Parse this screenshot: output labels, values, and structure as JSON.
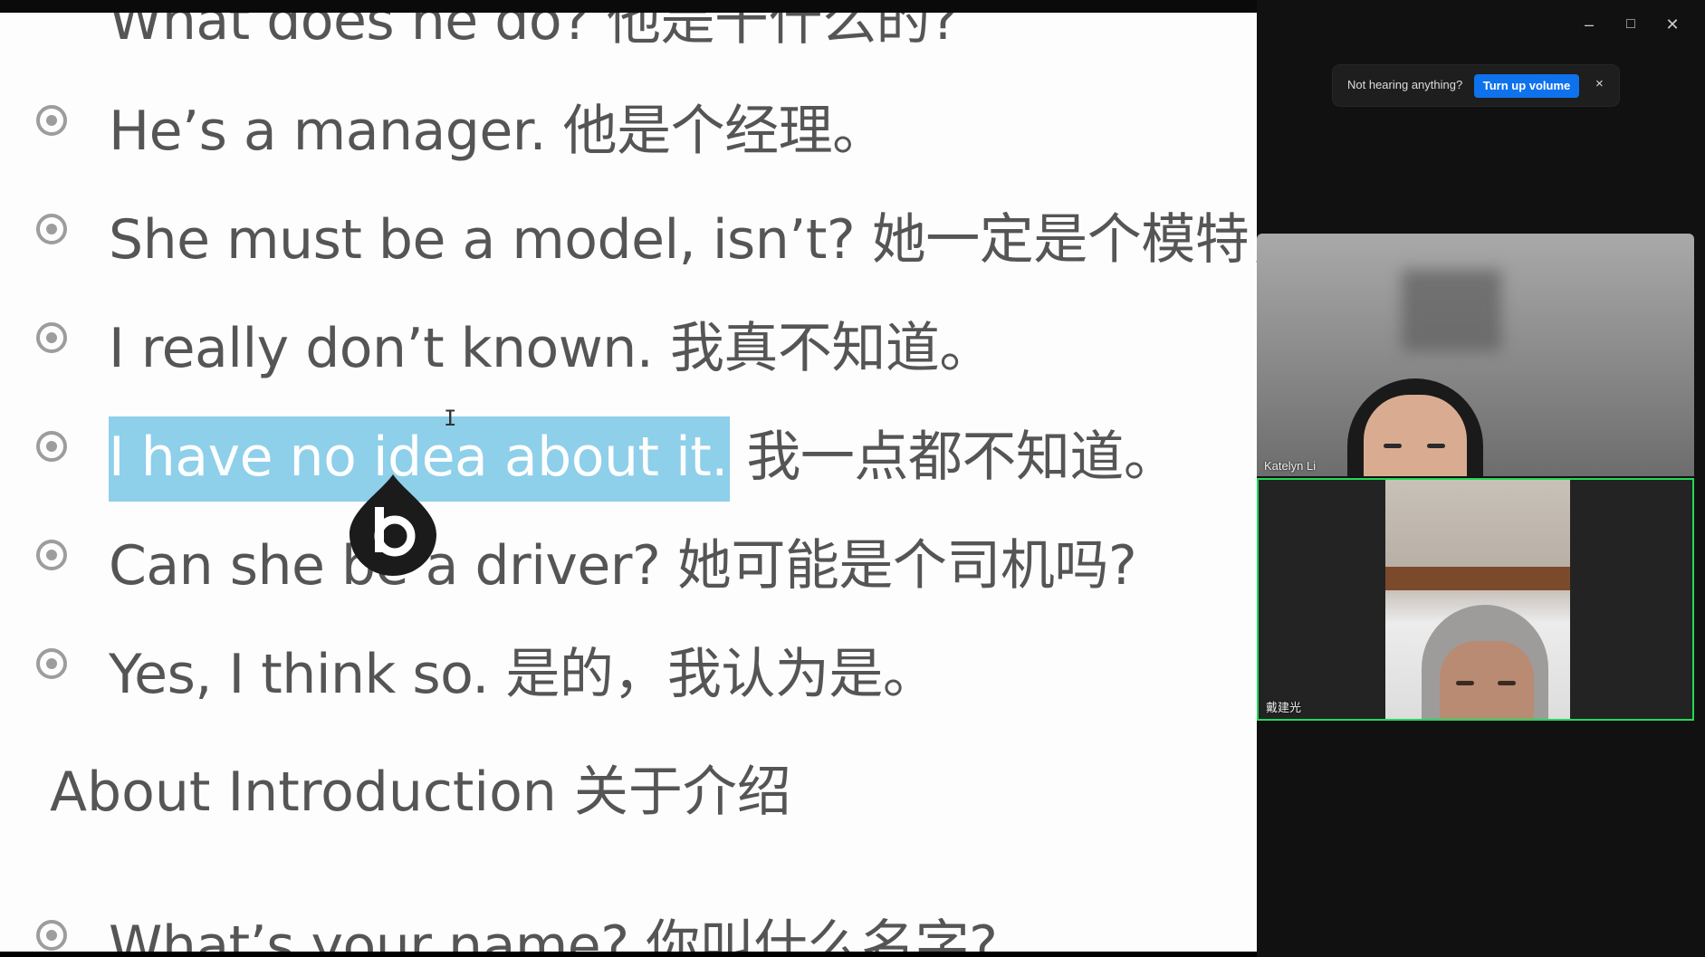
{
  "slide": {
    "top_partial": "What does he do? 他是干什么的?",
    "lines": [
      "He’s a manager. 他是个经理。",
      "She must be a model, isn’t? 她一定是个模特，不",
      "I really don’t known. 我真不知道。",
      "我一点都不知道。",
      "Can she be a driver? 她可能是个司机吗?",
      "Yes, I think so. 是的，我认为是。"
    ],
    "selected_text": "I have no idea about it.",
    "heading": "About Introduction 关于介绍",
    "bottom_line": "What’s your name? 你叫什么名字?"
  },
  "window": {
    "minimize_label": "–",
    "maximize_label": "□",
    "close_label": "✕"
  },
  "toast": {
    "message": "Not hearing anything?",
    "button": "Turn up volume",
    "close": "×"
  },
  "participants": [
    {
      "name": "Katelyn Li"
    },
    {
      "name": "戴建光"
    }
  ],
  "colors": {
    "selection": "#8ecfea",
    "active_speaker_border": "#23d959",
    "toast_button": "#0e72ed"
  }
}
